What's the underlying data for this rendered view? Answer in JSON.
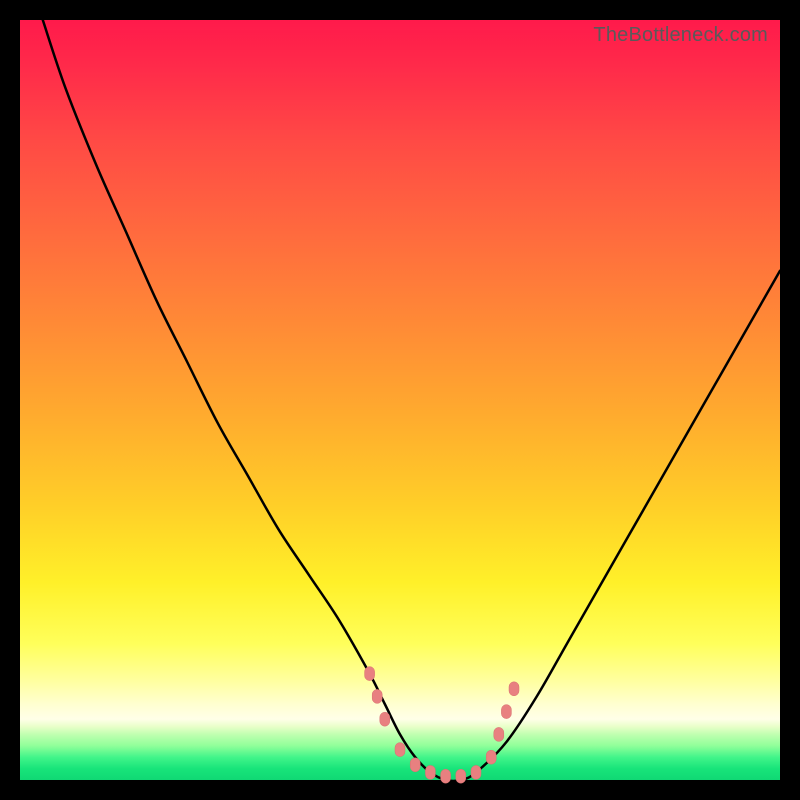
{
  "watermark": "TheBottleneck.com",
  "colors": {
    "frame": "#000000",
    "curve": "#000000",
    "marker": "#e88080"
  },
  "chart_data": {
    "type": "line",
    "title": "",
    "xlabel": "",
    "ylabel": "",
    "xlim": [
      0,
      100
    ],
    "ylim": [
      0,
      100
    ],
    "grid": false,
    "legend": false,
    "note": "gradient background from red (high mismatch) at top to green (optimal) at bottom; curve is approximate/estimated from pixels",
    "series": [
      {
        "name": "bottleneck-curve",
        "x": [
          3,
          6,
          10,
          14,
          18,
          22,
          26,
          30,
          34,
          38,
          42,
          46,
          48,
          50,
          52,
          54,
          56,
          58,
          60,
          64,
          68,
          72,
          76,
          80,
          84,
          88,
          92,
          96,
          100
        ],
        "y": [
          100,
          91,
          81,
          72,
          63,
          55,
          47,
          40,
          33,
          27,
          21,
          14,
          10,
          6,
          3,
          1,
          0,
          0,
          1,
          5,
          11,
          18,
          25,
          32,
          39,
          46,
          53,
          60,
          67
        ]
      }
    ],
    "markers": {
      "name": "optimal-zone-markers",
      "points": [
        {
          "x": 46,
          "y": 14
        },
        {
          "x": 47,
          "y": 11
        },
        {
          "x": 48,
          "y": 8
        },
        {
          "x": 50,
          "y": 4
        },
        {
          "x": 52,
          "y": 2
        },
        {
          "x": 54,
          "y": 1
        },
        {
          "x": 56,
          "y": 0.5
        },
        {
          "x": 58,
          "y": 0.5
        },
        {
          "x": 60,
          "y": 1
        },
        {
          "x": 62,
          "y": 3
        },
        {
          "x": 63,
          "y": 6
        },
        {
          "x": 64,
          "y": 9
        },
        {
          "x": 65,
          "y": 12
        }
      ]
    }
  }
}
